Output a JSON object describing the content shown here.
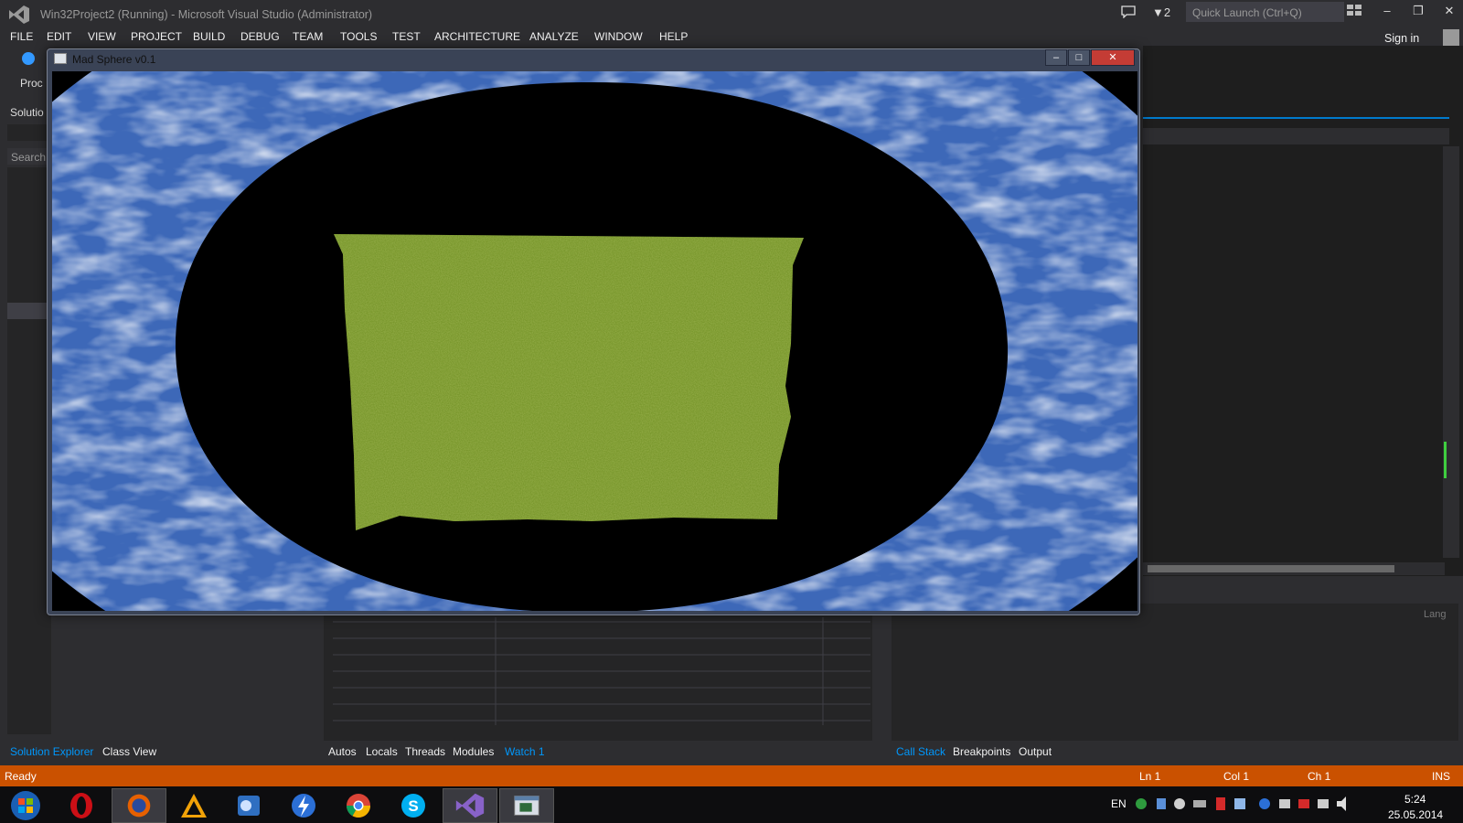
{
  "window": {
    "title": "Win32Project2 (Running) - Microsoft Visual Studio (Administrator)",
    "notification_count": "▼2",
    "quick_launch_placeholder": "Quick Launch (Ctrl+Q)",
    "sign_in": "Sign in"
  },
  "menu": [
    "FILE",
    "EDIT",
    "VIEW",
    "PROJECT",
    "BUILD",
    "DEBUG",
    "TEAM",
    "TOOLS",
    "TEST",
    "ARCHITECTURE",
    "ANALYZE",
    "WINDOW",
    "HELP"
  ],
  "left_panel": {
    "toolbar_label": "Proc",
    "header": "Solutio",
    "search_placeholder": "Search"
  },
  "right_panel": {
    "column_label": "Lang"
  },
  "bottom_tabs_left": [
    {
      "label": "Solution Explorer",
      "active": true
    },
    {
      "label": "Class View",
      "active": false
    }
  ],
  "bottom_tabs_middle": [
    {
      "label": "Autos",
      "active": false
    },
    {
      "label": "Locals",
      "active": false
    },
    {
      "label": "Threads",
      "active": false
    },
    {
      "label": "Modules",
      "active": false
    },
    {
      "label": "Watch 1",
      "active": true
    }
  ],
  "bottom_tabs_right": [
    {
      "label": "Call Stack",
      "active": true
    },
    {
      "label": "Breakpoints",
      "active": false
    },
    {
      "label": "Output",
      "active": false
    }
  ],
  "status": {
    "state": "Ready",
    "line": "Ln 1",
    "col": "Col 1",
    "ch": "Ch 1",
    "mode": "INS"
  },
  "game_window": {
    "title": "Mad Sphere v0.1"
  },
  "taskbar": {
    "icons": [
      "windows-start-icon",
      "opera-icon",
      "firefox-icon",
      "aimp-icon",
      "outlook-icon",
      "flash-icon",
      "chrome-icon",
      "skype-icon",
      "visual-studio-icon",
      "app-window-icon"
    ],
    "language": "EN",
    "time": "5:24",
    "date": "25.05.2014"
  },
  "colors": {
    "status_bar": "#ca5100",
    "accent": "#007acc",
    "active_tab": "#0097fb",
    "grass": "#6f8f22",
    "sky": "#3d68b8"
  }
}
